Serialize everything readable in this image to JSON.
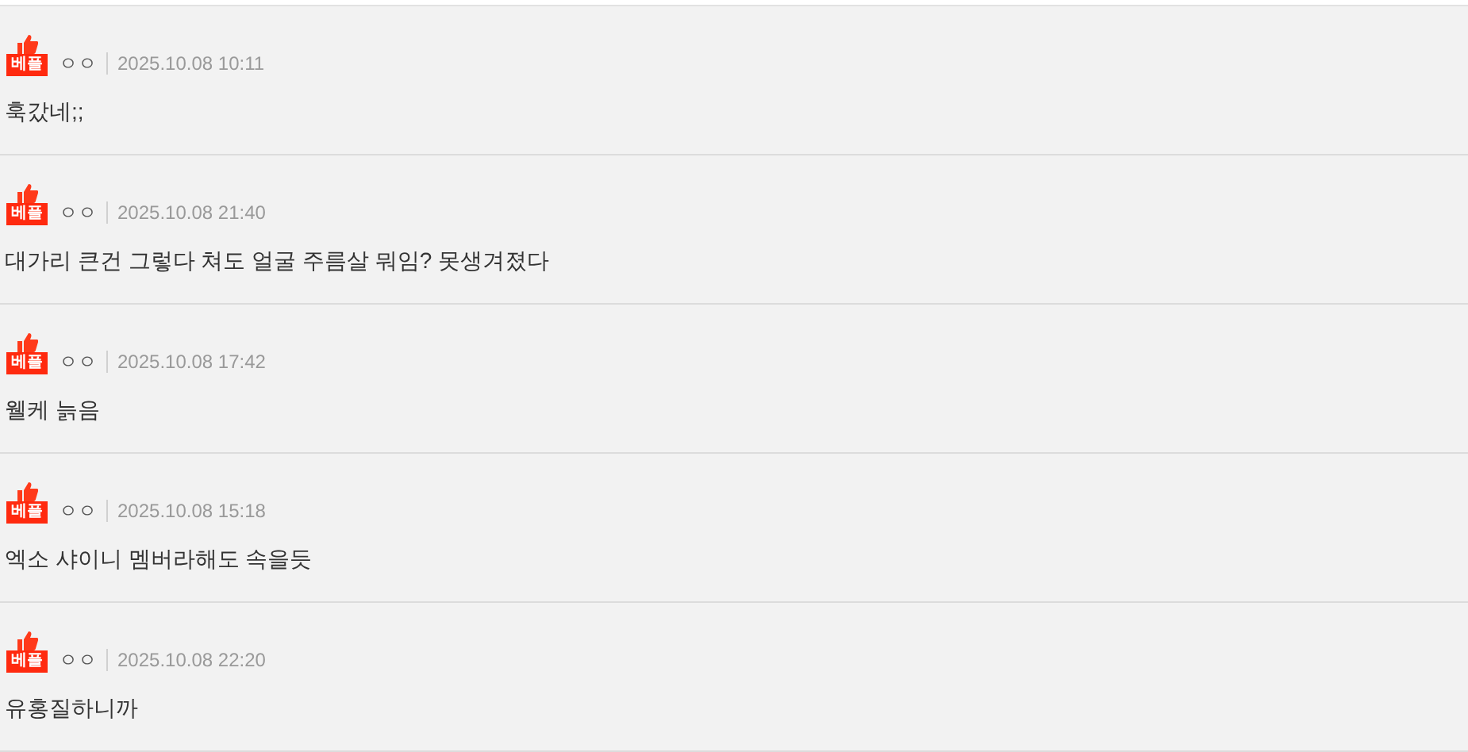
{
  "comments": [
    {
      "badge": "베플",
      "author": "ㅇㅇ",
      "date": "2025.10.08 10:11",
      "text": "훅갔네;;"
    },
    {
      "badge": "베플",
      "author": "ㅇㅇ",
      "date": "2025.10.08 21:40",
      "text": "대가리 큰건 그렇다 쳐도 얼굴 주름살 뭐임? 못생겨졌다"
    },
    {
      "badge": "베플",
      "author": "ㅇㅇ",
      "date": "2025.10.08 17:42",
      "text": "웰케 늙음"
    },
    {
      "badge": "베플",
      "author": "ㅇㅇ",
      "date": "2025.10.08 15:18",
      "text": "엑소 샤이니 멤버라해도 속을듯"
    },
    {
      "badge": "베플",
      "author": "ㅇㅇ",
      "date": "2025.10.08 22:20",
      "text": "유홍질하니까"
    }
  ]
}
